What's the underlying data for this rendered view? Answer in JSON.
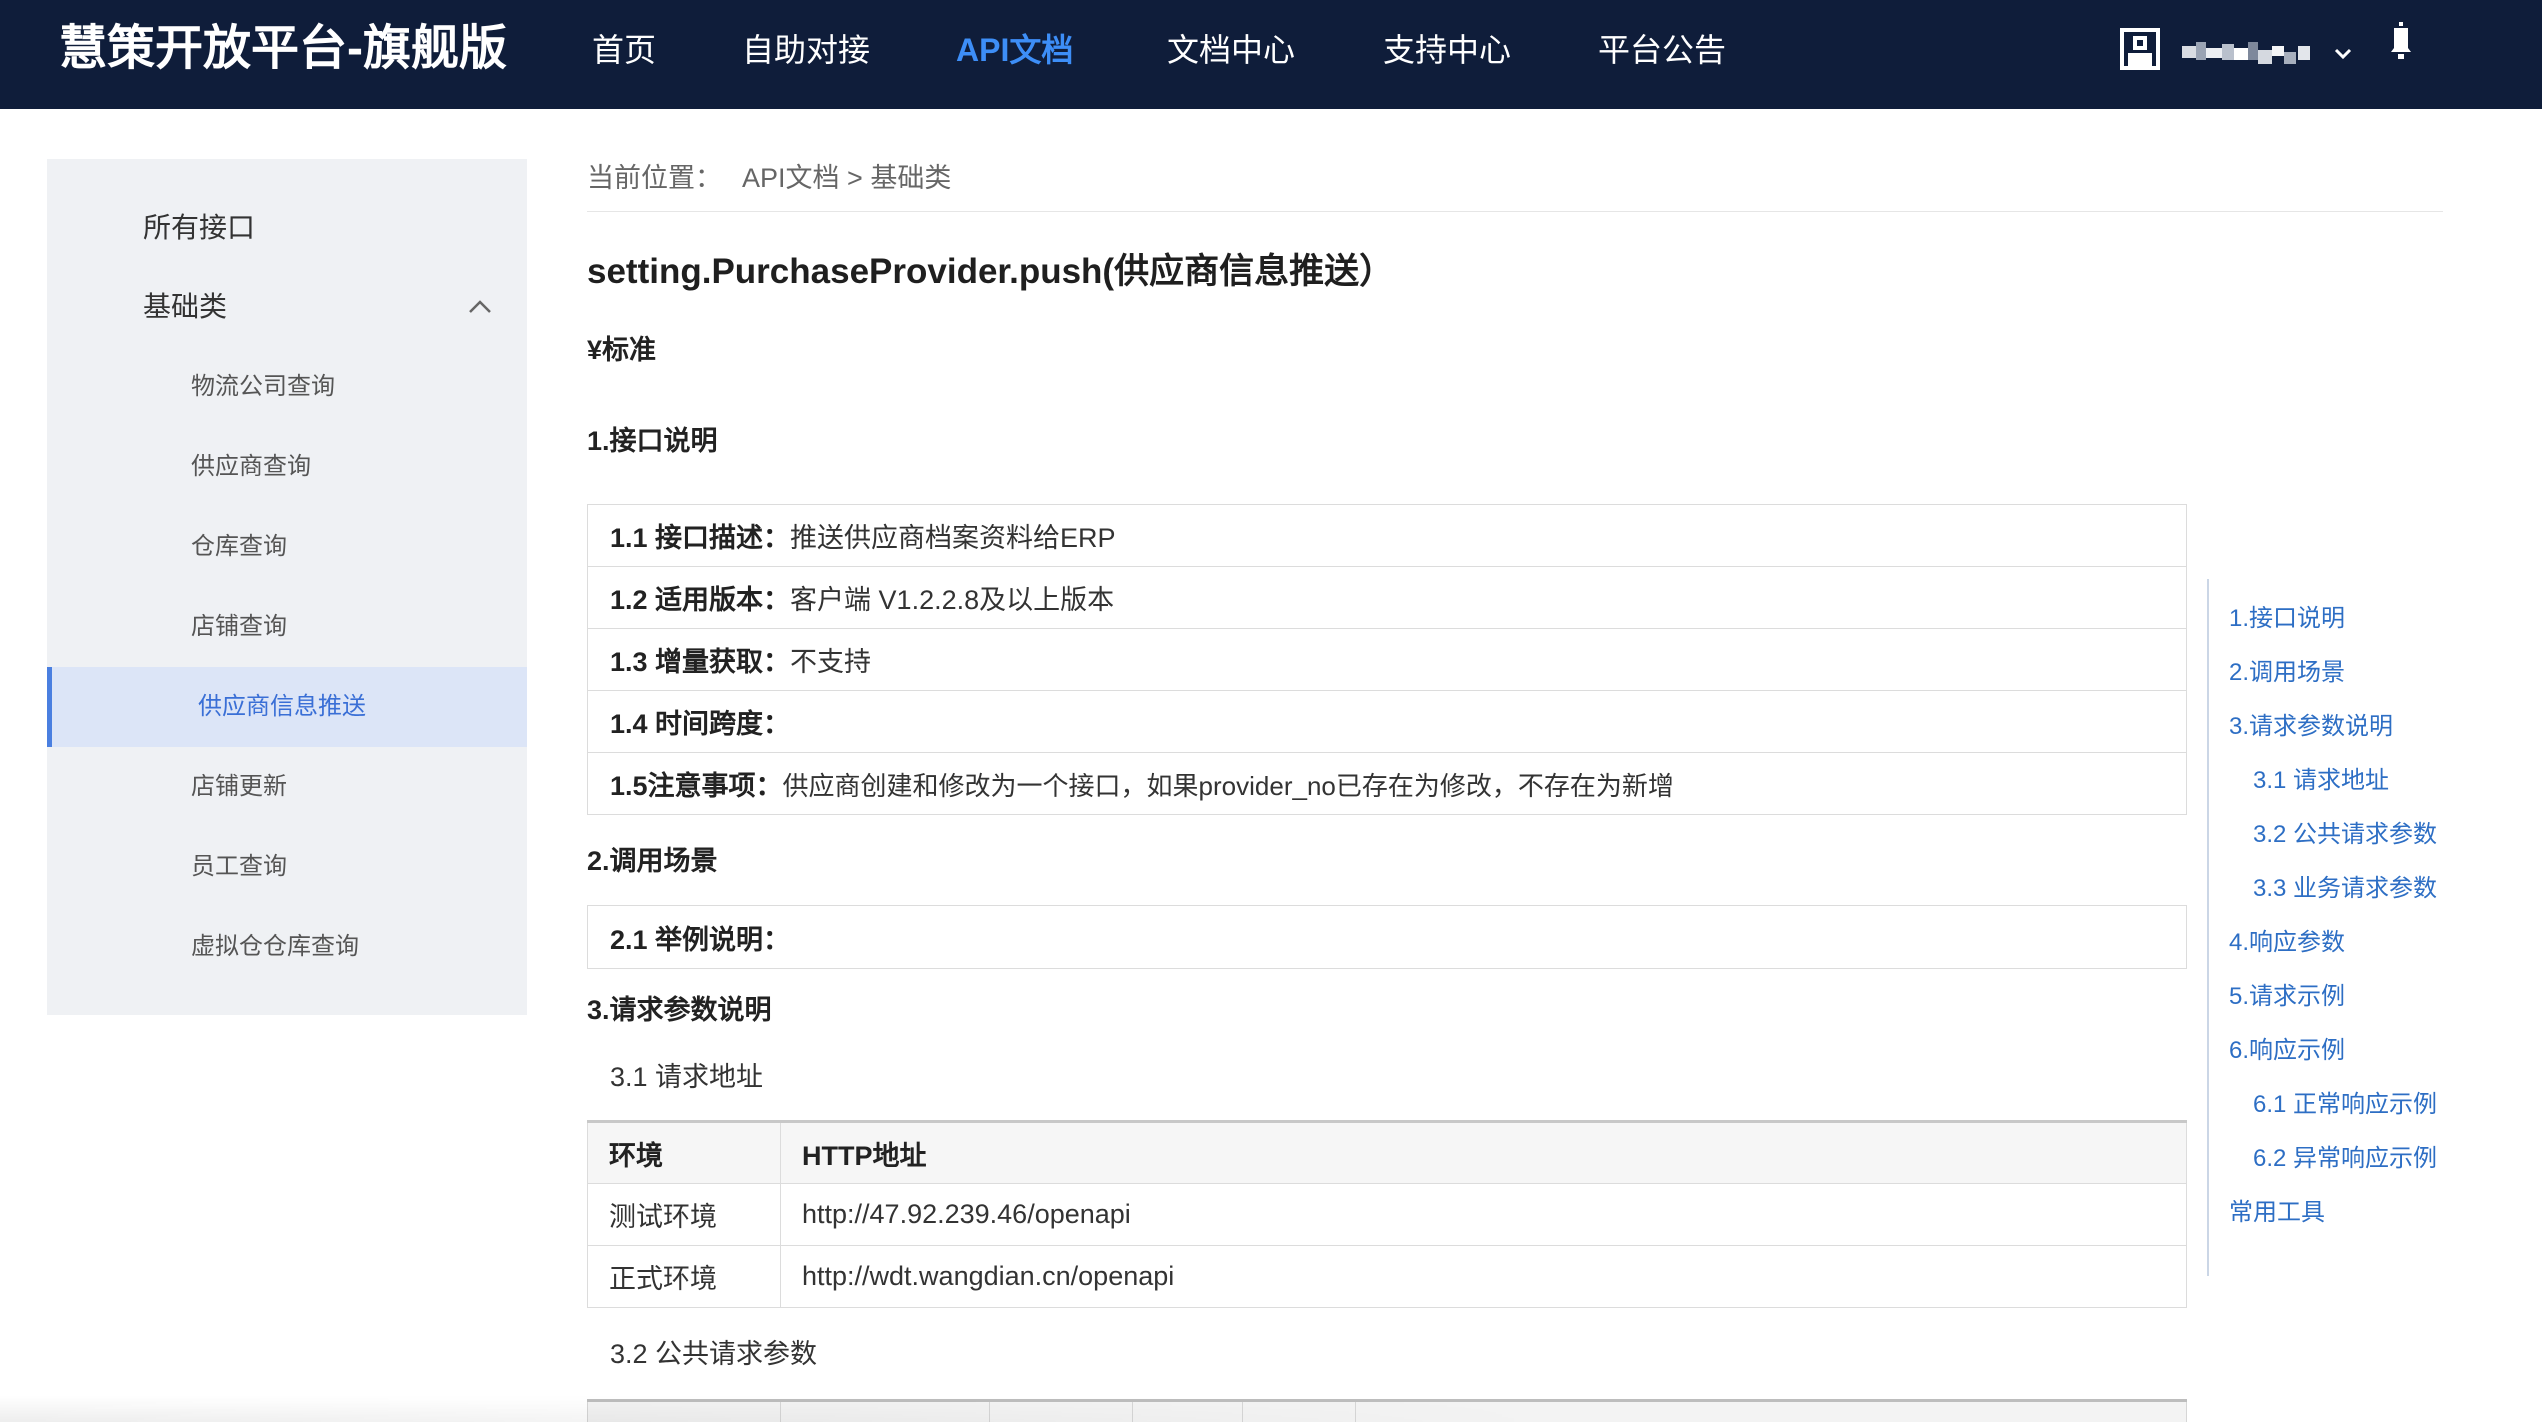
{
  "colors": {
    "header_bg": "#0f1d3a",
    "accent": "#3d8ef7",
    "sidebar_bg": "#eff1f4",
    "sidebar_active_bg": "#dce5f7",
    "sidebar_active_text": "#3a6fd6",
    "link": "#2d6ec4"
  },
  "header": {
    "brand": "慧策开放平台-旗舰版",
    "nav": [
      {
        "label": "首页"
      },
      {
        "label": "自助对接"
      },
      {
        "label": "API文档",
        "active": true
      },
      {
        "label": "文档中心"
      },
      {
        "label": "支持中心"
      },
      {
        "label": "平台公告"
      }
    ],
    "user": {
      "avatar_icon": "avatar-icon",
      "dropdown_icon": "chevron-down-icon",
      "notification_icon": "bell-icon"
    }
  },
  "sidebar": {
    "all_interfaces": "所有接口",
    "group": {
      "label": "基础类",
      "expanded": true,
      "toggle_icon": "chevron-up-icon"
    },
    "items": [
      {
        "label": "物流公司查询"
      },
      {
        "label": "供应商查询"
      },
      {
        "label": "仓库查询"
      },
      {
        "label": "店铺查询"
      },
      {
        "label": "供应商信息推送",
        "active": true
      },
      {
        "label": "店铺更新"
      },
      {
        "label": "员工查询"
      },
      {
        "label": "虚拟仓仓库查询"
      }
    ]
  },
  "breadcrumb": {
    "prefix": "当前位置：",
    "items": [
      "API文档",
      "基础类"
    ],
    "separator": ">"
  },
  "doc": {
    "title": "setting.PurchaseProvider.push(供应商信息推送）",
    "edition": "¥标准",
    "interface_spec": {
      "heading": "1.接口说明",
      "rows": [
        {
          "label": "1.1 接口描述：",
          "value": "推送供应商档案资料给ERP"
        },
        {
          "label": "1.2 适用版本：",
          "value": "客户端 V1.2.2.8及以上版本"
        },
        {
          "label": "1.3 增量获取：",
          "value": "不支持"
        },
        {
          "label": "1.4 时间跨度："
        },
        {
          "label": "1.5注意事项：",
          "value": "供应商创建和修改为一个接口，如果provider_no已存在为修改，不存在为新增"
        }
      ]
    },
    "scenario": {
      "heading": "2.调用场景",
      "rows": [
        {
          "label": "2.1 举例说明："
        }
      ]
    },
    "request_params": {
      "heading": "3.请求参数说明",
      "address": {
        "heading": "3.1 请求地址",
        "columns": [
          "环境",
          "HTTP地址"
        ],
        "rows": [
          [
            "测试环境",
            "http://47.92.239.46/openapi"
          ],
          [
            "正式环境",
            "http://wdt.wangdian.cn/openapi"
          ]
        ]
      },
      "public_params": {
        "heading": "3.2 公共请求参数"
      }
    }
  },
  "toc": [
    {
      "label": "1.接口说明",
      "level": 1
    },
    {
      "label": "2.调用场景",
      "level": 1
    },
    {
      "label": "3.请求参数说明",
      "level": 1
    },
    {
      "label": "3.1 请求地址",
      "level": 2
    },
    {
      "label": "3.2 公共请求参数",
      "level": 2
    },
    {
      "label": "3.3 业务请求参数",
      "level": 2
    },
    {
      "label": "4.响应参数",
      "level": 1
    },
    {
      "label": "5.请求示例",
      "level": 1
    },
    {
      "label": "6.响应示例",
      "level": 1
    },
    {
      "label": "6.1 正常响应示例",
      "level": 2
    },
    {
      "label": "6.2 异常响应示例",
      "level": 2
    },
    {
      "label": "常用工具",
      "level": 1
    }
  ]
}
